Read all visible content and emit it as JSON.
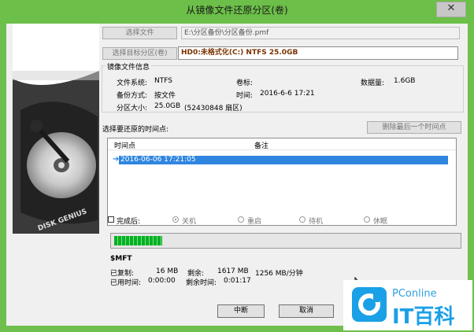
{
  "window": {
    "title": "从镜像文件还原分区(卷)",
    "close_glyph": "✕"
  },
  "image_file": {
    "button_label": "选择文件",
    "path": "E:\\分区备份\\分区备份.pmf"
  },
  "target": {
    "button_label": "选择目标分区(卷)",
    "value": "HD0:未格式化(C:) NTFS 25.0GB"
  },
  "info": {
    "title": "镜像文件信息",
    "filesystem_label": "文件系统:",
    "filesystem": "NTFS",
    "volume_label": "卷标:",
    "data_size_label": "数据量:",
    "data_size": "1.6GB",
    "backup_method_label": "备份方式:",
    "backup_method": "按文件",
    "time_label": "时间:",
    "time": "2016-6-6 17:21",
    "partition_size_label": "分区大小:",
    "partition_size": "25.0GB",
    "sectors": "(52430848 扇区)"
  },
  "timepoints": {
    "label": "选择要还原的时间点:",
    "delete_button": "删除最后一个时间点",
    "columns": [
      "时间点",
      "备注"
    ],
    "rows": [
      {
        "time": "2016-06-06 17:21:05",
        "note": ""
      }
    ],
    "selected_index": 0
  },
  "after_done": {
    "label": "完成后:",
    "options": [
      "关机",
      "重启",
      "待机",
      "休眠"
    ],
    "selected": "关机",
    "checked": false
  },
  "progress": {
    "fraction": 0.14,
    "current_file": "$MFT"
  },
  "stats": {
    "copied_label": "已复制:",
    "copied": "16 MB",
    "remaining_label": "剩余:",
    "remaining": "1617 MB",
    "speed": "1256 MB/分钟",
    "elapsed_label": "已用时间:",
    "elapsed": "0:00:00",
    "remaining_time_label": "剩余时间:",
    "remaining_time": "0:01:17"
  },
  "buttons": {
    "abort": "中断",
    "cancel": "取消"
  },
  "watermark": {
    "brand": "PConline",
    "name": "IT百科"
  },
  "colors": {
    "titlebar": "#6cbf48",
    "selection": "#2f85e0",
    "progress": "#06b025",
    "target_text": "#7b3200"
  },
  "icons": {
    "disk_image": "hard-disk-image",
    "selection_marker": "arrow-right-icon",
    "pconline_logo": "pconline-logo"
  }
}
